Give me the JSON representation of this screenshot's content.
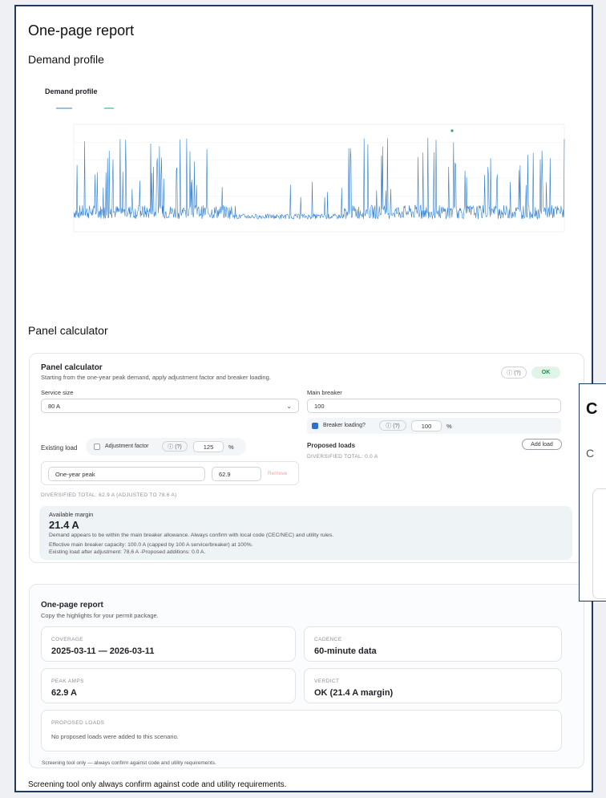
{
  "report": {
    "title": "One-page report",
    "section_demand": "Demand profile",
    "section_panel": "Panel calculator",
    "footer": "Screening tool only    always confirm against code and utility requirements."
  },
  "chart_data": {
    "type": "line",
    "title": "Demand profile",
    "subtitle": "",
    "series": [
      {
        "name": ""
      }
    ],
    "peak_label": "",
    "ylabel": "",
    "xlabel": "",
    "grid": true,
    "legend": "top-left",
    "colors": {
      "line": "#2f7fd0",
      "peak": "#2aa86a"
    }
  },
  "calc": {
    "title": "Panel calculator",
    "subtitle": "Starting from the one-year peak demand, apply adjustment factor and breaker loading.",
    "badge_info": "ⓘ (?)",
    "badge_ok": "OK",
    "service_size_label": "Service size",
    "service_size_value": "80 A",
    "main_breaker_label": "Main breaker",
    "main_breaker_value": "100",
    "breaker_loading_label": "Breaker loading?",
    "breaker_loading_info": "ⓘ (?)",
    "breaker_loading_value": "100",
    "percent": "%",
    "existing_load_label": "Existing load",
    "adjustment_factor_label": "Adjustment factor",
    "adjustment_info": "ⓘ (?)",
    "adjustment_value": "125",
    "proposed_loads_label": "Proposed loads",
    "add_load_button": "Add load",
    "proposed_total": "DIVERSIFIED TOTAL: 0.0 A",
    "row_name": "One-year peak",
    "row_value": "62.9",
    "row_remove": "Remove",
    "diversified_total": "DIVERSIFIED TOTAL: 62.9 A (ADJUSTED TO 78.6 A)",
    "margin_label": "Available margin",
    "margin_value": "21.4 A",
    "margin_note": "Demand appears to be within the main breaker allowance. Always confirm with local code (CEC/NEC) and utility rules.",
    "margin_detail_1": "Effective main breaker capacity: 100.0 A (capped by 100 A service/breaker) at 100%.",
    "margin_detail_2": "Existing load after adjustment: 78.6 A -Proposed additions: 0.0 A."
  },
  "summary": {
    "title": "One-page report",
    "subtitle": "Copy the highlights for your permit package.",
    "coverage_label": "COVERAGE",
    "coverage_value": "2025-03-11 — 2026-03-11",
    "cadence_label": "CADENCE",
    "cadence_value": "60-minute data",
    "peak_label": "PEAK AMPS",
    "peak_value": "62.9 A",
    "verdict_label": "VERDICT",
    "verdict_value": "OK (21.4 A margin)",
    "proposed_label": "PROPOSED LOADS",
    "proposed_value": "No proposed loads were added to this scenario.",
    "footnote": "Screening tool only — always confirm against code and utility requirements."
  },
  "side": {
    "heading": "C",
    "subheading": "C"
  }
}
